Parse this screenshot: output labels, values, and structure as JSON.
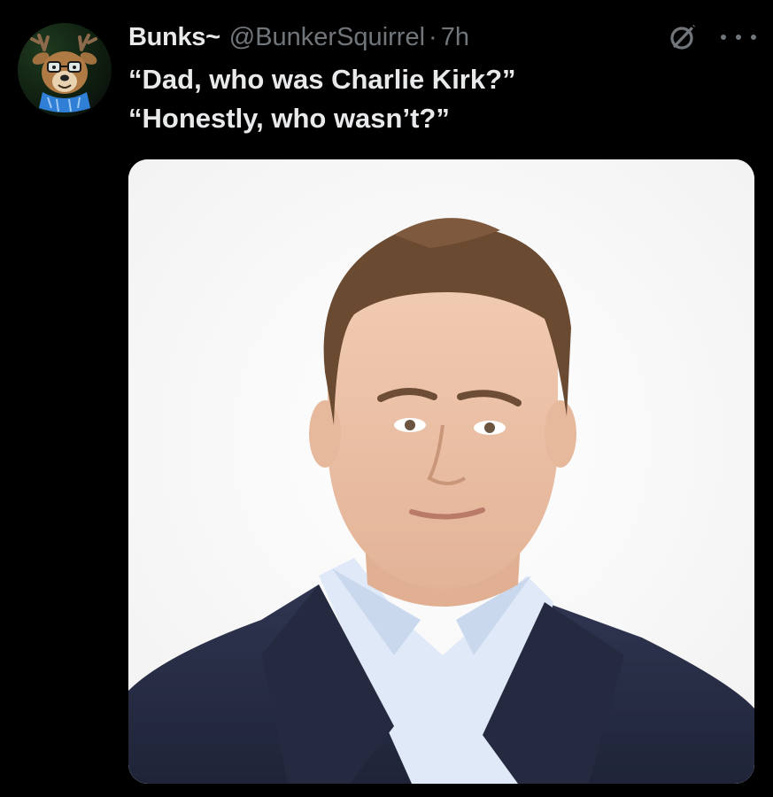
{
  "post": {
    "display_name": "Bunks~",
    "handle": "@BunkerSquirrel",
    "separator": "·",
    "time": "7h",
    "text_lines": [
      "“Dad, who was Charlie Kirk?”",
      "“Honestly, who wasn’t?”"
    ]
  },
  "icons": {
    "avatar": "deer-character-avatar",
    "grok": "grok-icon",
    "more": "more-options-icon"
  },
  "colors": {
    "background": "#000000",
    "primary_text": "#e7e9ea",
    "secondary_text": "#71767b"
  }
}
